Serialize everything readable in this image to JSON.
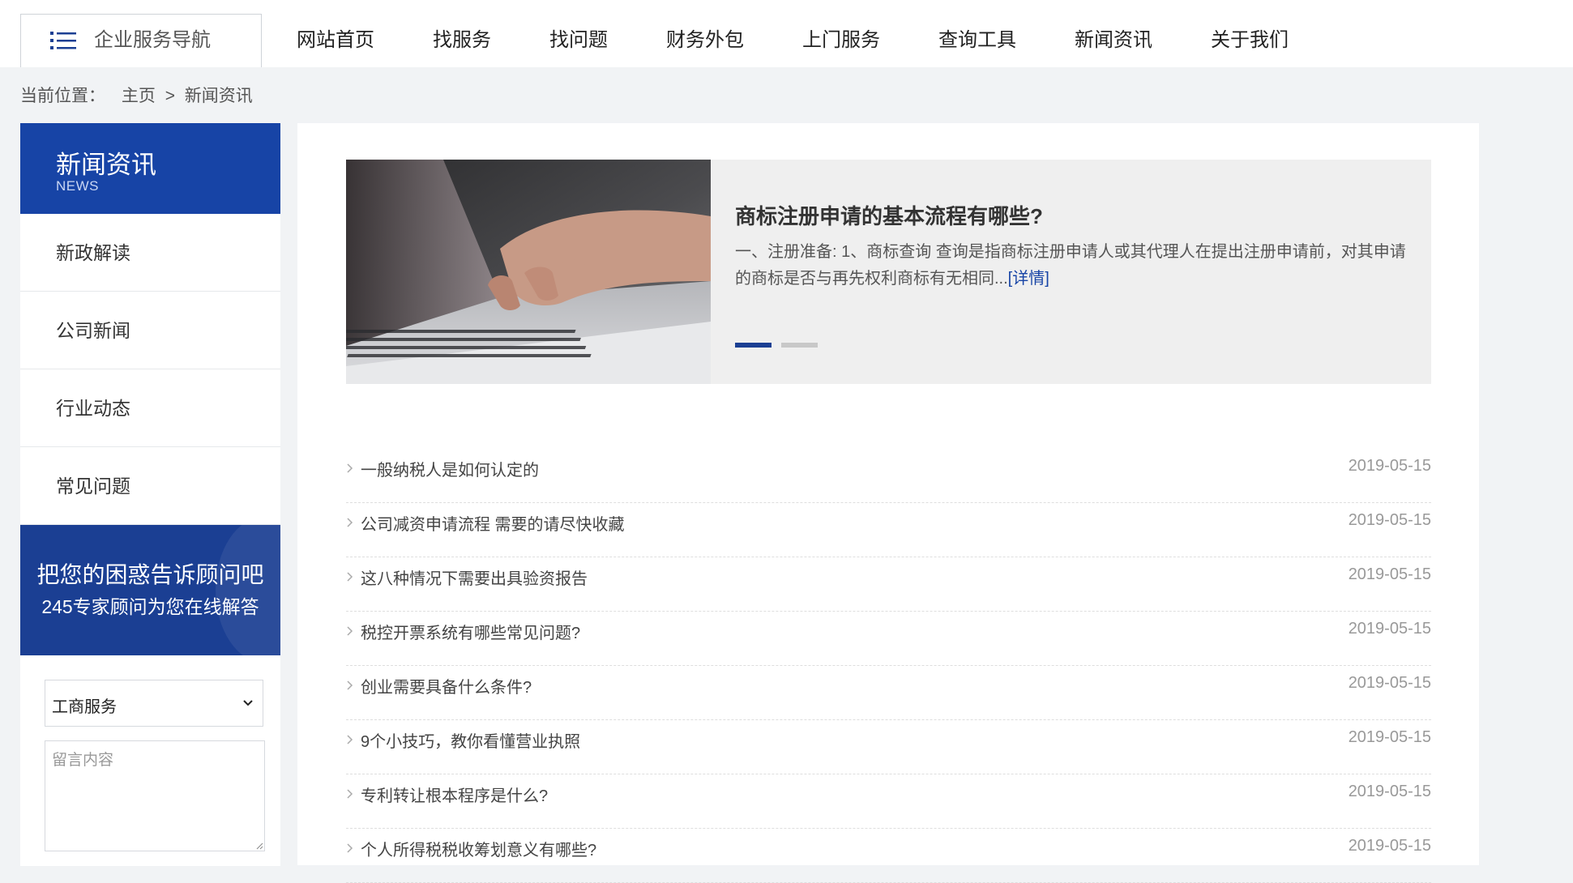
{
  "nav": {
    "guide_label": "企业服务导航",
    "items": [
      "网站首页",
      "找服务",
      "找问题",
      "财务外包",
      "上门服务",
      "查询工具",
      "新闻资讯",
      "关于我们"
    ]
  },
  "breadcrumb": {
    "prefix": "当前位置：",
    "home": "主页",
    "separator": ">",
    "current": "新闻资讯"
  },
  "sidebar": {
    "title": "新闻资讯",
    "subtitle": "NEWS",
    "items": [
      "新政解读",
      "公司新闻",
      "行业动态",
      "常见问题"
    ],
    "consult_line1": "把您的困惑告诉顾问吧",
    "consult_line2": "245专家顾问为您在线解答",
    "select_value": "工商服务",
    "message_placeholder": "留言内容"
  },
  "featured": {
    "title": "商标注册申请的基本流程有哪些?",
    "excerpt": "一、注册准备: 1、商标查询 查询是指商标注册申请人或其代理人在提出注册申请前，对其申请的商标是否与再先权利商标有无相同...",
    "detail_label": "[详情]"
  },
  "news": [
    {
      "title": "一般纳税人是如何认定的",
      "date": "2019-05-15"
    },
    {
      "title": "公司减资申请流程 需要的请尽快收藏",
      "date": "2019-05-15"
    },
    {
      "title": "这八种情况下需要出具验资报告",
      "date": "2019-05-15"
    },
    {
      "title": "税控开票系统有哪些常见问题?",
      "date": "2019-05-15"
    },
    {
      "title": "创业需要具备什么条件?",
      "date": "2019-05-15"
    },
    {
      "title": "9个小技巧，教你看懂营业执照",
      "date": "2019-05-15"
    },
    {
      "title": "专利转让根本程序是什么?",
      "date": "2019-05-15"
    },
    {
      "title": "个人所得税税收筹划意义有哪些?",
      "date": "2019-05-15"
    }
  ],
  "colors": {
    "brand_blue": "#1744a6",
    "consult_blue": "#1b3f93",
    "page_bg": "#f1f3f5"
  }
}
